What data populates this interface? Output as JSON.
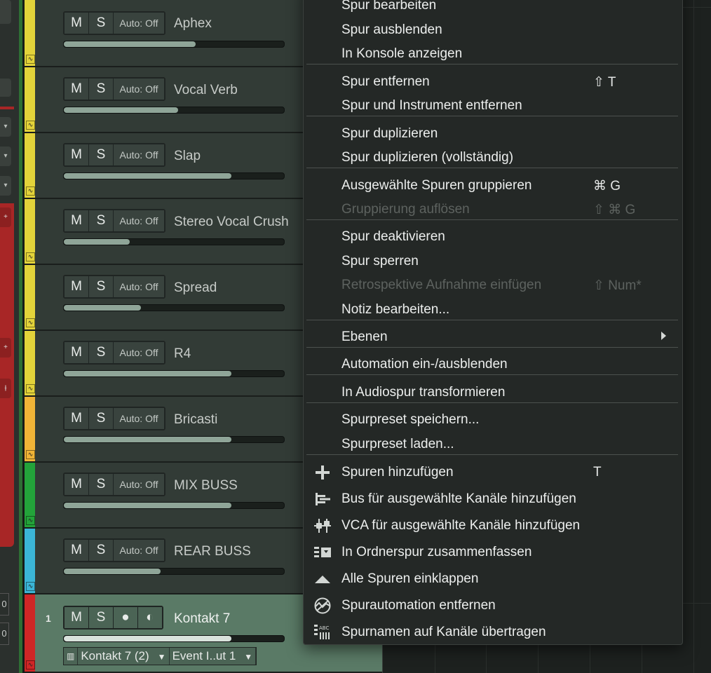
{
  "menu": {
    "items": [
      {
        "label": "Spur bearbeiten",
        "shortcut": "",
        "disabled": false
      },
      {
        "label": "Spur ausblenden",
        "shortcut": "",
        "disabled": false
      },
      {
        "label": "In Konsole anzeigen",
        "shortcut": "",
        "disabled": false
      },
      {
        "label": "Spur entfernen",
        "shortcut": "⇧ T",
        "disabled": false
      },
      {
        "label": "Spur und Instrument entfernen",
        "shortcut": "",
        "disabled": false
      },
      {
        "label": "Spur duplizieren",
        "shortcut": "",
        "disabled": false
      },
      {
        "label": "Spur duplizieren (vollständig)",
        "shortcut": "",
        "disabled": false
      },
      {
        "label": "Ausgewählte Spuren gruppieren",
        "shortcut": "⌘ G",
        "disabled": false
      },
      {
        "label": "Gruppierung auflösen",
        "shortcut": "⇧ ⌘ G",
        "disabled": true
      },
      {
        "label": "Spur deaktivieren",
        "shortcut": "",
        "disabled": false
      },
      {
        "label": "Spur sperren",
        "shortcut": "",
        "disabled": false
      },
      {
        "label": "Retrospektive Aufnahme einfügen",
        "shortcut": "⇧ Num*",
        "disabled": true
      },
      {
        "label": "Notiz bearbeiten...",
        "shortcut": "",
        "disabled": false
      },
      {
        "label": "Ebenen",
        "shortcut": "",
        "disabled": false,
        "submenu": true
      },
      {
        "label": "Automation ein-/ausblenden",
        "shortcut": "",
        "disabled": false
      },
      {
        "label": "In Audiospur transformieren",
        "shortcut": "",
        "disabled": false
      },
      {
        "label": "Spurpreset speichern...",
        "shortcut": "",
        "disabled": false
      },
      {
        "label": "Spurpreset laden...",
        "shortcut": "",
        "disabled": false
      },
      {
        "label": "Spuren hinzufügen",
        "shortcut": "T",
        "disabled": false,
        "icon": "plus-icon"
      },
      {
        "label": "Bus für ausgewählte Kanäle hinzufügen",
        "shortcut": "",
        "disabled": false,
        "icon": "bus-icon"
      },
      {
        "label": "VCA für ausgewählte Kanäle hinzufügen",
        "shortcut": "",
        "disabled": false,
        "icon": "vca-icon"
      },
      {
        "label": "In Ordnerspur zusammenfassen",
        "shortcut": "",
        "disabled": false,
        "icon": "folder-pack-icon"
      },
      {
        "label": "Alle Spuren einklappen",
        "shortcut": "",
        "disabled": false,
        "icon": "collapse-icon"
      },
      {
        "label": "Spurautomation entfernen",
        "shortcut": "",
        "disabled": false,
        "icon": "remove-automation-icon"
      },
      {
        "label": "Spurnamen auf Kanäle übertragen",
        "shortcut": "",
        "disabled": false,
        "icon": "track-names-icon"
      }
    ]
  },
  "tracks": [
    {
      "name": "Aphex",
      "color": "#e3d33a",
      "mute": "M",
      "solo": "S",
      "auto": "Auto: Off",
      "level": 0.6
    },
    {
      "name": "Vocal Verb",
      "color": "#e3d33a",
      "mute": "M",
      "solo": "S",
      "auto": "Auto: Off",
      "level": 0.52
    },
    {
      "name": "Slap",
      "color": "#e3d33a",
      "mute": "M",
      "solo": "S",
      "auto": "Auto: Off",
      "level": 0.76
    },
    {
      "name": "Stereo Vocal Crush",
      "color": "#e3d33a",
      "mute": "M",
      "solo": "S",
      "auto": "Auto: Off",
      "level": 0.3
    },
    {
      "name": "Spread",
      "color": "#e3d33a",
      "mute": "M",
      "solo": "S",
      "auto": "Auto: Off",
      "level": 0.35
    },
    {
      "name": "R4",
      "color": "#e3d33a",
      "mute": "M",
      "solo": "S",
      "auto": "Auto: Off",
      "level": 0.76
    },
    {
      "name": "Bricasti",
      "color": "#f0b437",
      "mute": "M",
      "solo": "S",
      "auto": "Auto: Off",
      "level": 0.76
    },
    {
      "name": "MIX BUSS",
      "color": "#23a33a",
      "mute": "M",
      "solo": "S",
      "auto": "Auto: Off",
      "level": 0.76
    },
    {
      "name": "REAR BUSS",
      "color": "#3bb5d6",
      "mute": "M",
      "solo": "S",
      "auto": "Auto: Off",
      "level": 0.44
    }
  ],
  "instrument_track": {
    "number": "1",
    "name": "Kontakt 7",
    "color": "#cf2626",
    "mute": "M",
    "solo": "S",
    "record": "●",
    "monitor": "◐",
    "level": 0.76,
    "instrument": "Kontakt 7 (2)",
    "output": "Event I..ut 1"
  },
  "left_panel": {
    "values": [
      "0",
      "0"
    ]
  }
}
